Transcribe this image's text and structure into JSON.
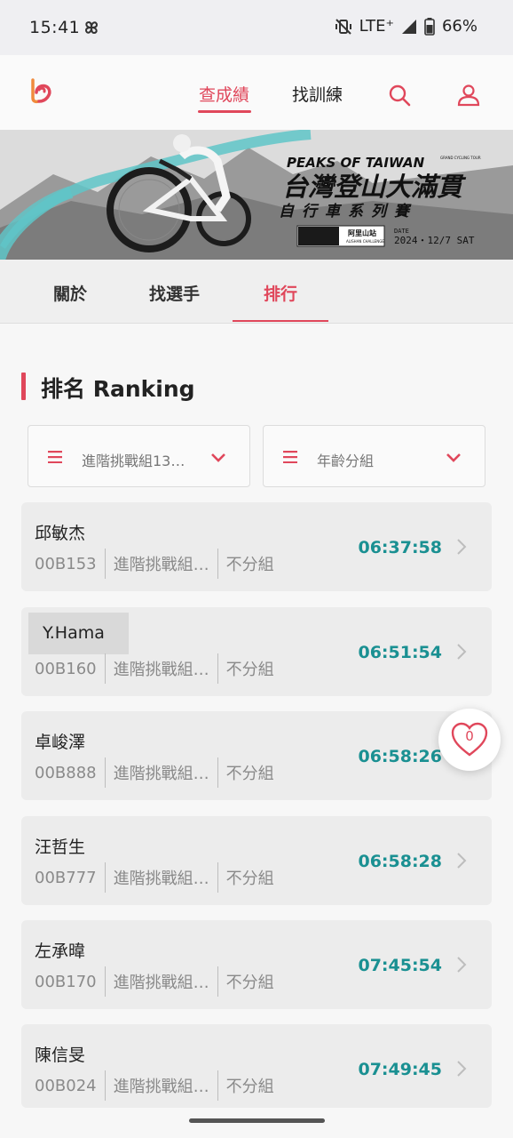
{
  "status_bar": {
    "time": "15:41",
    "network": "LTE⁺",
    "battery": "66%"
  },
  "header": {
    "tabs": [
      {
        "label": "查成績",
        "active": true
      },
      {
        "label": "找訓練",
        "active": false
      }
    ],
    "icons": [
      "logo-icon",
      "search-icon",
      "user-icon"
    ],
    "accent_color": "#e0475b"
  },
  "banner": {
    "brand": "PEAKS OF TAIWAN",
    "brand_small": "GRAND CYCLING TOUR",
    "title": "台灣登山大滿貫",
    "subtitle": "自行車系列賽",
    "date_label": "DATE",
    "date": "2024・12/7 SAT",
    "sponsor": "阿里山站",
    "sponsor_sub": "ALISHAN CHALLENGE"
  },
  "sub_tabs": [
    {
      "label": "關於",
      "active": false
    },
    {
      "label": "找選手",
      "active": false
    },
    {
      "label": "排行",
      "active": true
    }
  ],
  "ranking": {
    "title": "排名 Ranking",
    "filters": [
      {
        "selected": "進階挑戰組13…"
      },
      {
        "selected": "年齡分組"
      }
    ],
    "results": [
      {
        "name": "邱敏杰",
        "bib": "00B153",
        "category": "進階挑戰組…",
        "group": "不分組",
        "time": "06:37:58"
      },
      {
        "name": "Y.Hama",
        "bib": "00B160",
        "category": "進階挑戰組…",
        "group": "不分組",
        "time": "06:51:54"
      },
      {
        "name": "卓峻澤",
        "bib": "00B888",
        "category": "進階挑戰組…",
        "group": "不分組",
        "time": "06:58:26"
      },
      {
        "name": "汪哲生",
        "bib": "00B777",
        "category": "進階挑戰組…",
        "group": "不分組",
        "time": "06:58:28"
      },
      {
        "name": "左承暐",
        "bib": "00B170",
        "category": "進階挑戰組…",
        "group": "不分組",
        "time": "07:45:54"
      },
      {
        "name": "陳信旻",
        "bib": "00B024",
        "category": "進階挑戰組…",
        "group": "不分組",
        "time": "07:49:45"
      }
    ],
    "time_color": "#1a9092"
  },
  "favorite": {
    "count": "0"
  }
}
